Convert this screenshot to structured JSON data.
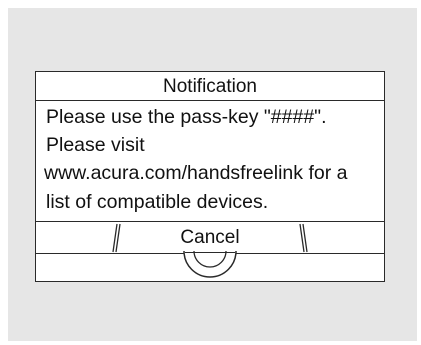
{
  "dialog": {
    "title": "Notification",
    "message_lines": [
      "Please use the pass-key \"####\".",
      "Please visit",
      "www.acura.com/handsfreelink for a",
      "list of compatible devices."
    ],
    "cancel_label": "Cancel"
  },
  "colors": {
    "background": "#e6e6e6",
    "dialog": "#ffffff",
    "border": "#2a2a2a"
  }
}
